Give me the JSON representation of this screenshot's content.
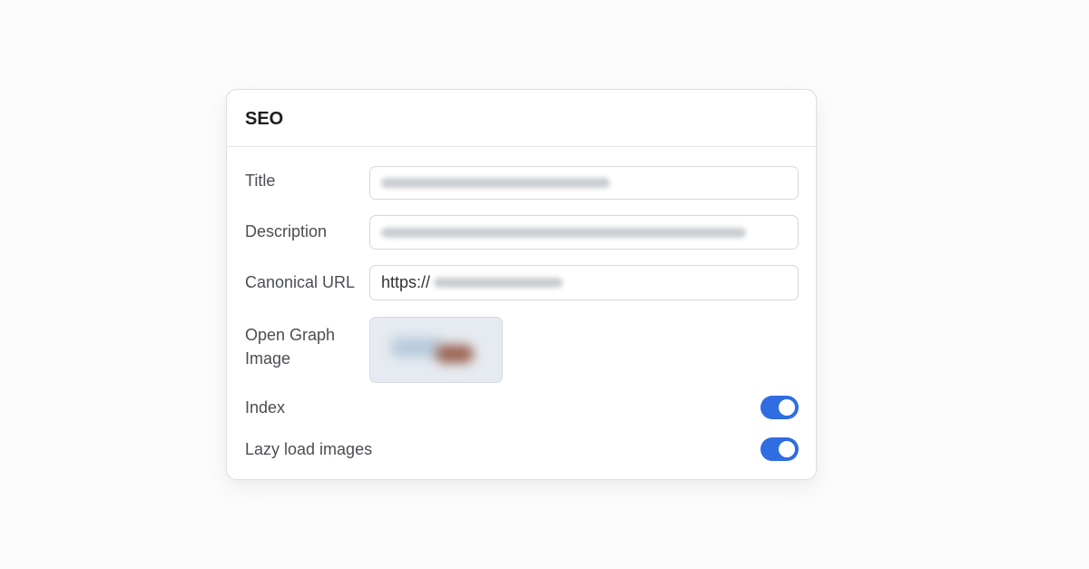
{
  "panel": {
    "title": "SEO",
    "fields": {
      "title_label": "Title",
      "description_label": "Description",
      "canonical_label": "Canonical URL",
      "canonical_prefix": "https://",
      "og_image_label_line1": "Open Graph",
      "og_image_label_line2": "Image",
      "index_label": "Index",
      "lazy_label": "Lazy load images"
    },
    "toggles": {
      "index_on": true,
      "lazy_load_on": true
    },
    "colors": {
      "accent": "#2f6de1"
    }
  }
}
